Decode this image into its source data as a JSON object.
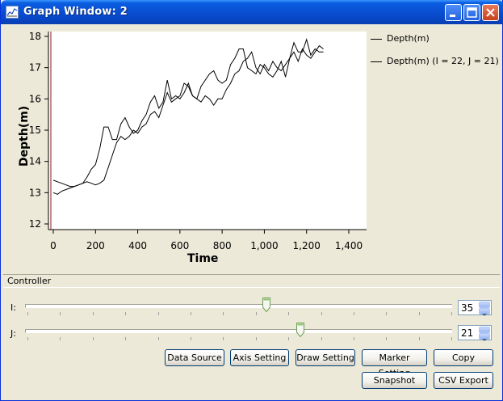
{
  "window": {
    "title": "Graph Window: 2",
    "controls": [
      "minimize-icon",
      "maximize-icon",
      "close-icon"
    ]
  },
  "chart_data": {
    "type": "line",
    "xlabel": "Time",
    "ylabel": "Depth(m)",
    "xlim": [
      0,
      1400
    ],
    "ylim": [
      12,
      18
    ],
    "xticks": [
      "0",
      "200",
      "400",
      "600",
      "800",
      "1,000",
      "1,200",
      "1,400"
    ],
    "yticks": [
      "12",
      "13",
      "14",
      "15",
      "16",
      "17",
      "18"
    ],
    "legend_position": "right",
    "series": [
      {
        "name": "Depth(m)",
        "x": [
          0,
          20,
          40,
          60,
          80,
          100,
          120,
          140,
          160,
          180,
          200,
          220,
          240,
          260,
          280,
          300,
          320,
          340,
          360,
          380,
          400,
          420,
          440,
          460,
          480,
          500,
          520,
          540,
          560,
          580,
          600,
          620,
          640,
          660,
          680,
          700,
          720,
          740,
          760,
          780,
          800,
          820,
          840,
          860,
          880,
          900,
          920,
          940,
          960,
          980,
          1000,
          1020,
          1040,
          1060,
          1080,
          1100,
          1120,
          1140,
          1160,
          1180,
          1200,
          1220,
          1240,
          1260,
          1280
        ],
        "values": [
          13.4,
          13.35,
          13.3,
          13.25,
          13.2,
          13.2,
          13.25,
          13.3,
          13.5,
          13.75,
          13.9,
          14.4,
          15.1,
          15.1,
          14.7,
          14.7,
          15.2,
          15.4,
          15.1,
          14.9,
          15.0,
          15.3,
          15.5,
          15.9,
          16.1,
          15.7,
          15.9,
          16.6,
          16.0,
          16.1,
          16.0,
          16.2,
          16.5,
          16.1,
          16.0,
          16.4,
          16.6,
          16.8,
          16.9,
          16.6,
          16.5,
          16.6,
          17.1,
          17.3,
          17.6,
          17.6,
          17.0,
          16.9,
          16.8,
          17.1,
          17.0,
          16.8,
          16.7,
          16.9,
          17.2,
          16.7,
          17.3,
          17.8,
          17.5,
          17.5,
          17.9,
          17.4,
          17.6,
          17.5,
          17.5
        ],
        "color": "#000000"
      },
      {
        "name": "Depth(m) (I = 22, J = 21)",
        "x": [
          0,
          20,
          40,
          60,
          80,
          100,
          120,
          140,
          160,
          180,
          200,
          220,
          240,
          260,
          280,
          300,
          320,
          340,
          360,
          380,
          400,
          420,
          440,
          460,
          480,
          500,
          520,
          540,
          560,
          580,
          600,
          620,
          640,
          660,
          680,
          700,
          720,
          740,
          760,
          780,
          800,
          820,
          840,
          860,
          880,
          900,
          920,
          940,
          960,
          980,
          1000,
          1020,
          1040,
          1060,
          1080,
          1100,
          1120,
          1140,
          1160,
          1180,
          1200,
          1220,
          1240,
          1260,
          1280
        ],
        "values": [
          13.0,
          12.95,
          13.05,
          13.1,
          13.15,
          13.2,
          13.25,
          13.3,
          13.35,
          13.3,
          13.25,
          13.3,
          13.4,
          13.8,
          14.2,
          14.6,
          14.8,
          14.7,
          14.8,
          15.0,
          14.9,
          15.1,
          15.2,
          15.5,
          15.6,
          15.4,
          15.8,
          16.2,
          15.9,
          16.0,
          16.1,
          16.5,
          16.4,
          16.1,
          16.0,
          15.9,
          16.1,
          16.0,
          15.8,
          16.0,
          16.0,
          16.3,
          16.5,
          16.8,
          16.9,
          17.2,
          17.3,
          17.5,
          17.0,
          16.8,
          17.1,
          16.9,
          17.2,
          17.0,
          16.9,
          17.1,
          17.3,
          17.5,
          17.2,
          17.6,
          17.4,
          17.3,
          17.5,
          17.7,
          17.6
        ],
        "color": "#000000"
      }
    ]
  },
  "controller": {
    "header": "Controller",
    "sliders": [
      {
        "label": "I:",
        "value": "35",
        "position": 0.566
      },
      {
        "label": "J:",
        "value": "21",
        "position": 0.645
      }
    ]
  },
  "buttons": {
    "data_source": "Data Source",
    "axis_setting": "Axis Setting",
    "draw_setting": "Draw Setting",
    "marker_setting": "Marker Setting",
    "copy": "Copy",
    "snapshot": "Snapshot",
    "csv_export": "CSV Export"
  }
}
